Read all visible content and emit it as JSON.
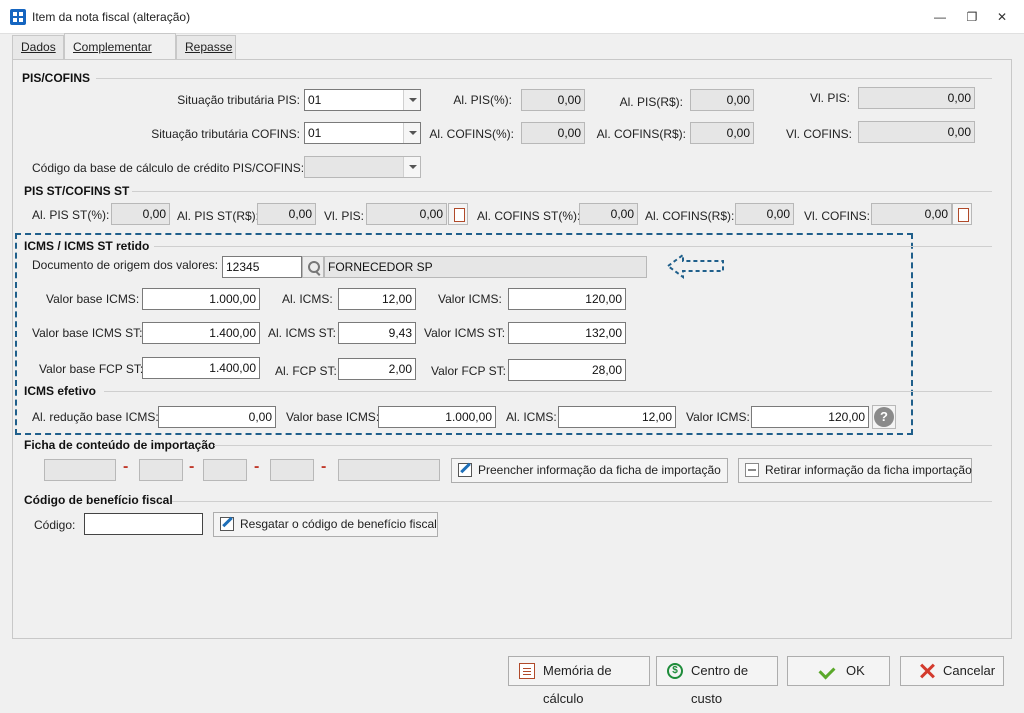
{
  "window": {
    "title": "Item da nota fiscal (alteração)",
    "minimize": "—",
    "restore": "❐",
    "close": "✕"
  },
  "tabs": [
    {
      "label": "Dados"
    },
    {
      "label": "Complementar"
    },
    {
      "label": "Repasse"
    }
  ],
  "pis_cofins": {
    "title": "PIS/COFINS",
    "sit_pis_label": "Situação tributária PIS:",
    "sit_pis_value": "01",
    "sit_cofins_label": "Situação tributária COFINS:",
    "sit_cofins_value": "01",
    "cod_base_label": "Código da base de cálculo de crédito PIS/COFINS:",
    "cod_base_value": "",
    "al_pis_pct_label": "Al. PIS(%):",
    "al_pis_pct": "0,00",
    "al_pis_rs_label": "Al. PIS(R$):",
    "al_pis_rs": "0,00",
    "vl_pis_label": "Vl. PIS:",
    "vl_pis": "0,00",
    "al_cofins_pct_label": "Al. COFINS(%):",
    "al_cofins_pct": "0,00",
    "al_cofins_rs_label": "Al. COFINS(R$):",
    "al_cofins_rs": "0,00",
    "vl_cofins_label": "Vl. COFINS:",
    "vl_cofins": "0,00"
  },
  "pis_cofins_st": {
    "title": "PIS ST/COFINS ST",
    "al_pis_st_pct_label": "Al. PIS ST(%):",
    "al_pis_st_pct": "0,00",
    "al_pis_st_rs_label": "Al. PIS ST(R$):",
    "al_pis_st_rs": "0,00",
    "vl_pis_label": "Vl. PIS:",
    "vl_pis": "0,00",
    "al_cofins_st_pct_label": "Al. COFINS ST(%):",
    "al_cofins_st_pct": "0,00",
    "al_cofins_rs_label": "Al. COFINS(R$):",
    "al_cofins_rs": "0,00",
    "vl_cofins_label": "Vl. COFINS:",
    "vl_cofins": "0,00"
  },
  "icms_retido": {
    "title": "ICMS / ICMS ST retido",
    "doc_label": "Documento de origem dos valores:",
    "doc_value": "12345",
    "doc_name": "FORNECEDOR SP",
    "vl_base_icms_label": "Valor base ICMS:",
    "vl_base_icms": "1.000,00",
    "al_icms_label": "Al. ICMS:",
    "al_icms": "12,00",
    "vl_icms_label": "Valor ICMS:",
    "vl_icms": "120,00",
    "vl_base_icms_st_label": "Valor base ICMS ST:",
    "vl_base_icms_st": "1.400,00",
    "al_icms_st_label": "Al. ICMS ST:",
    "al_icms_st": "9,43",
    "vl_icms_st_label": "Valor ICMS ST:",
    "vl_icms_st": "132,00",
    "vl_base_fcp_st_label": "Valor base FCP ST:",
    "vl_base_fcp_st": "1.400,00",
    "al_fcp_st_label": "Al. FCP ST:",
    "al_fcp_st": "2,00",
    "vl_fcp_st_label": "Valor FCP ST:",
    "vl_fcp_st": "28,00"
  },
  "icms_efetivo": {
    "title": "ICMS efetivo",
    "al_reducao_label": "Al. redução base ICMS:",
    "al_reducao": "0,00",
    "vl_base_icms_label": "Valor base ICMS:",
    "vl_base_icms": "1.000,00",
    "al_icms_label": "Al. ICMS:",
    "al_icms": "12,00",
    "vl_icms_label": "Valor ICMS:",
    "vl_icms": "120,00",
    "help": "?"
  },
  "ficha": {
    "title": "Ficha de conteúdo de importação",
    "sep": "-",
    "preencher_label": "Preencher informação da ficha de importação",
    "retirar_label": "Retirar informação da ficha importação"
  },
  "beneficio": {
    "title": "Código de benefício fiscal",
    "codigo_label": "Código:",
    "codigo_value": "",
    "resgatar_label": "Resgatar o código de benefício fiscal"
  },
  "footer": {
    "memoria_label": "Memória de cálculo",
    "centro_label": "Centro de custo",
    "ok_label": "OK",
    "cancelar_label": "Cancelar",
    "dollar": "$"
  },
  "colors": {
    "dash_border": "#1f5f8b",
    "arrow": "#1f5f8b",
    "separator_red": "#c0392b"
  }
}
